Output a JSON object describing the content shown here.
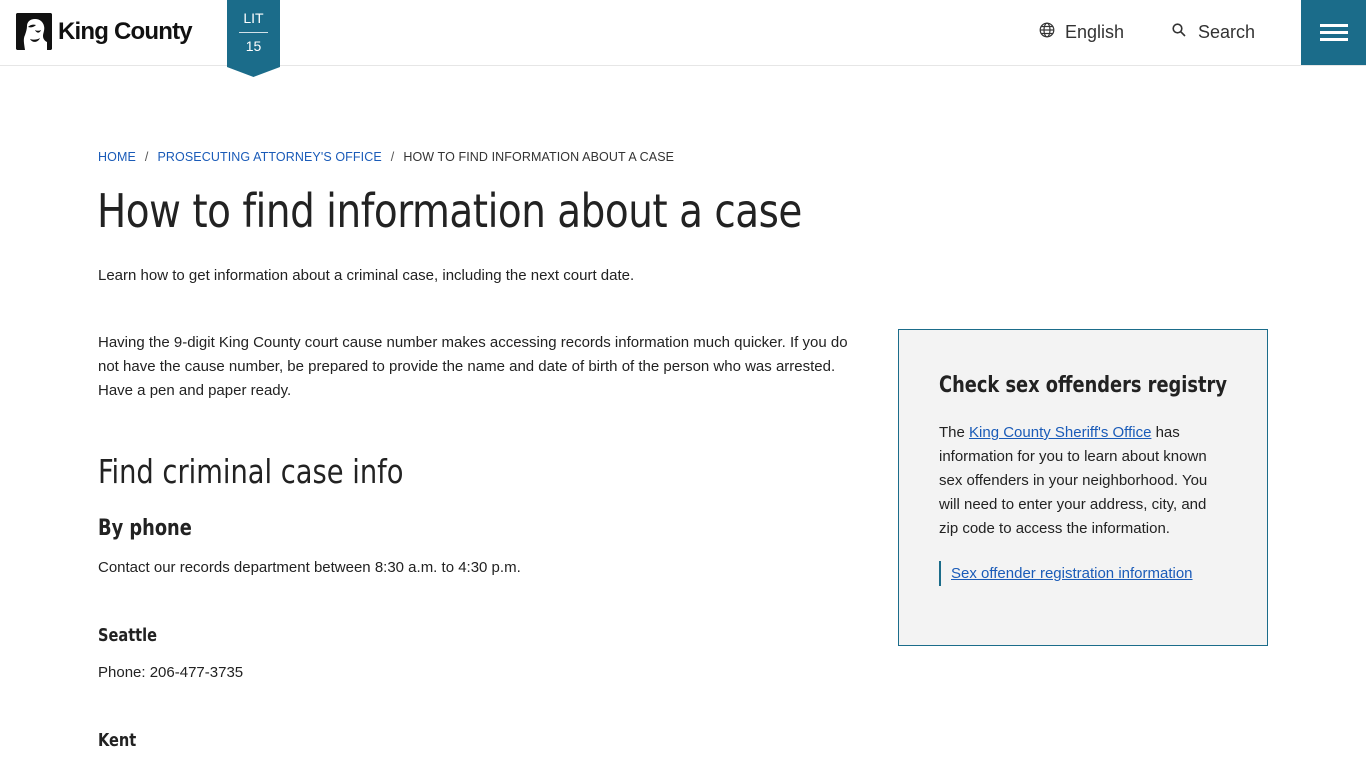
{
  "header": {
    "logo_text": "King County",
    "badge": {
      "top": "LIT",
      "bottom": "15"
    },
    "language_label": "English",
    "search_label": "Search",
    "accent_color": "#1b6c8a"
  },
  "breadcrumb": {
    "items": [
      "HOME",
      "PROSECUTING ATTORNEY'S OFFICE"
    ],
    "current": "HOW TO FIND INFORMATION ABOUT A CASE",
    "separator": "/"
  },
  "main": {
    "title": "How to find information about a case",
    "intro": "Learn how to get information about a criminal case, including the next court date.",
    "paragraph": "Having the 9-digit King County court cause number makes accessing records information much quicker. If you do not have the cause number, be prepared to provide the name and date of birth of the person who was arrested. Have a pen and paper ready.",
    "section_heading": "Find criminal case info",
    "subheading": "By phone",
    "contact_text": "Contact our records department between 8:30 a.m. to 4:30 p.m.",
    "locations": [
      {
        "name": "Seattle",
        "phone": "Phone: 206-477-3735"
      },
      {
        "name": "Kent"
      }
    ]
  },
  "sidebar": {
    "title": "Check sex offenders registry",
    "text_before": "The ",
    "link": "King County Sheriff's Office",
    "text_after": " has information for you to learn about known sex offenders in your neighborhood. You will need to enter your address, city, and zip code to access the information.",
    "cta": "Sex offender registration information"
  }
}
